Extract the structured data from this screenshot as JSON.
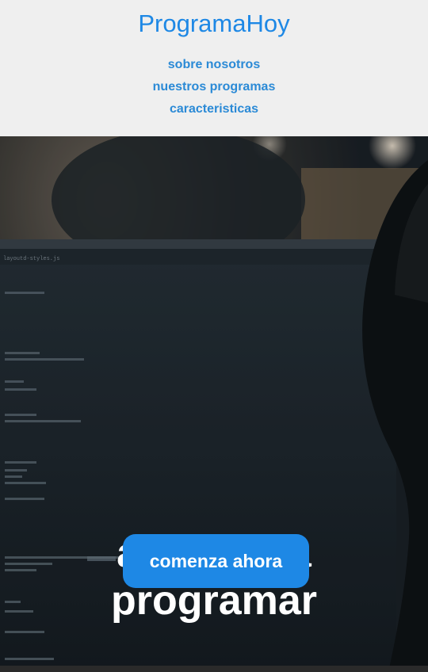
{
  "brand": "ProgramaHoy",
  "nav": {
    "items": [
      "sobre nosotros",
      "nuestros programas",
      "caracteristicas"
    ]
  },
  "hero": {
    "title_line1": "aprende a",
    "title_line2": "programar",
    "cta_label": "comenza ahora",
    "editor_tab": "layoutd-styles.js"
  },
  "colors": {
    "accent": "#1e88e5",
    "header_bg": "#efefef",
    "hero_dark": "#1a2229"
  }
}
